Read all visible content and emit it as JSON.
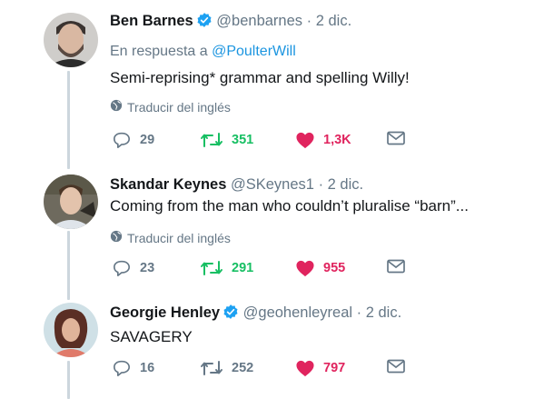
{
  "tweets": [
    {
      "name": "Ben Barnes",
      "verified": true,
      "handle": "@benbarnes",
      "separator": "·",
      "date": "2 dic.",
      "reply_prefix": "En respuesta a",
      "reply_mention": "@PoulterWill",
      "text": "Semi-reprising* grammar and spelling Willy!",
      "translate": "Traducir del inglés",
      "replies": "29",
      "retweets": "351",
      "retweets_active": true,
      "likes": "1,3K"
    },
    {
      "name": "Skandar Keynes",
      "verified": false,
      "handle": "@SKeynes1",
      "separator": "·",
      "date": "2 dic.",
      "text": "Coming from the man who couldn’t pluralise “barn”...",
      "translate": "Traducir del inglés",
      "replies": "23",
      "retweets": "291",
      "retweets_active": true,
      "likes": "955"
    },
    {
      "name": "Georgie Henley",
      "verified": true,
      "handle": "@geohenleyreal",
      "separator": "·",
      "date": "2 dic.",
      "text": "SAVAGERY",
      "replies": "16",
      "retweets": "252",
      "retweets_active": false,
      "likes": "797"
    }
  ],
  "colors": {
    "verified": "#1da1f2",
    "retweet": "#17bf63",
    "like": "#e0245e",
    "muted": "#657786",
    "thread_line": "#ccd6dd"
  }
}
